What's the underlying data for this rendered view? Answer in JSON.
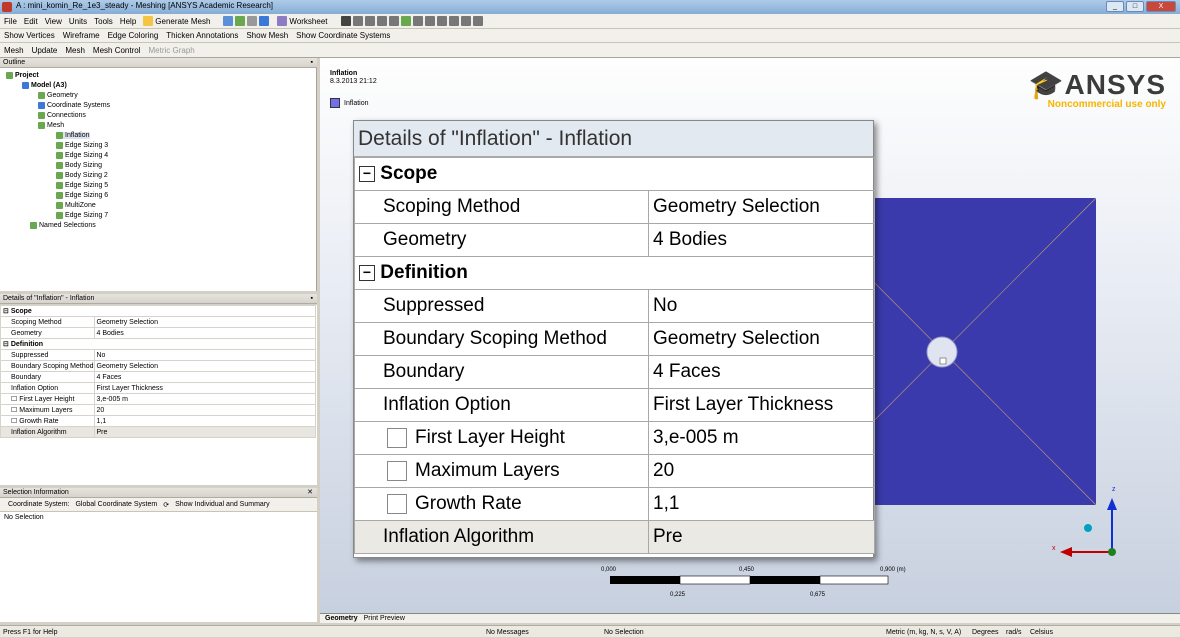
{
  "window": {
    "title": "A : mini_komin_Re_1e3_steady - Meshing [ANSYS Academic Research]",
    "buttons": [
      "_",
      "□",
      "X"
    ]
  },
  "menu": [
    "File",
    "Edit",
    "View",
    "Units",
    "Tools",
    "Help"
  ],
  "toolbar1": {
    "generate_mesh": "Generate Mesh",
    "worksheet": "Worksheet"
  },
  "toolbar2": [
    "Show Vertices",
    "Wireframe",
    "Edge Coloring",
    "Thicken Annotations",
    "Show Mesh",
    "Show Coordinate Systems"
  ],
  "toolbar3": {
    "mesh": "Mesh",
    "update": "Update",
    "mesh_menu": "Mesh",
    "mesh_control": "Mesh Control",
    "metric_graph": "Metric Graph"
  },
  "outline": {
    "header": "Outline",
    "items": [
      "Project",
      "Model (A3)",
      "Geometry",
      "Coordinate Systems",
      "Connections",
      "Mesh",
      "Inflation",
      "Edge Sizing 3",
      "Edge Sizing 4",
      "Body Sizing",
      "Body Sizing 2",
      "Edge Sizing 5",
      "Edge Sizing 6",
      "MultiZone",
      "Edge Sizing 7",
      "Named Selections"
    ]
  },
  "details": {
    "header": "Details of \"Inflation\" - Inflation",
    "scope_group": "Scope",
    "definition_group": "Definition",
    "rows": [
      {
        "k": "Scoping Method",
        "v": "Geometry Selection"
      },
      {
        "k": "Geometry",
        "v": "4 Bodies"
      },
      {
        "k": "Suppressed",
        "v": "No"
      },
      {
        "k": "Boundary Scoping Method",
        "v": "Geometry Selection"
      },
      {
        "k": "Boundary",
        "v": "4 Faces"
      },
      {
        "k": "Inflation Option",
        "v": "First Layer Thickness"
      },
      {
        "k": "First Layer Height",
        "v": "3,e-005 m"
      },
      {
        "k": "Maximum Layers",
        "v": "20"
      },
      {
        "k": "Growth Rate",
        "v": "1,1"
      },
      {
        "k": "Inflation Algorithm",
        "v": "Pre"
      }
    ]
  },
  "selection": {
    "header": "Selection Information",
    "coord_label": "Coordinate System:",
    "coord_value": "Global Coordinate System",
    "show_individual": "Show Individual and Summary",
    "no_selection": "No Selection"
  },
  "viewport": {
    "title": "Inflation",
    "date": "8.3.2013 21:12",
    "legend": "Inflation",
    "logo_text": "ANSYS",
    "logo_sub": "Noncommercial use only",
    "scale": {
      "l0": "0,000",
      "l1": "0,450",
      "l2": "0,900 (m)",
      "l3": "0,225",
      "l4": "0,675"
    },
    "axis_x": "x",
    "axis_z": "z"
  },
  "tabs": [
    "Geometry",
    "Print Preview"
  ],
  "status": {
    "help": "Press F1 for Help",
    "messages": "No Messages",
    "selection": "No Selection",
    "units": "Metric (m, kg, N, s, V, A)",
    "angle": "Degrees",
    "rad": "rad/s",
    "temp": "Celsius"
  },
  "colors": {
    "accent": "#f7b500",
    "body": "#3a3aac",
    "legend": "#7070e8"
  }
}
